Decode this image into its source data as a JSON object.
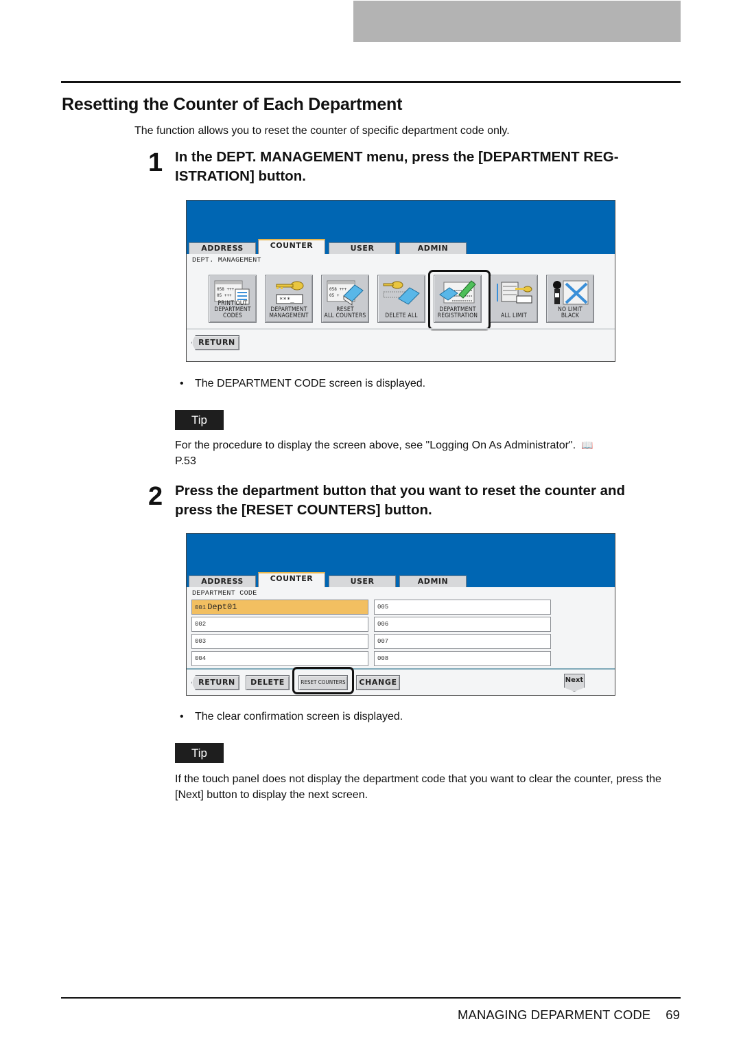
{
  "page": {
    "section_title": "Resetting the Counter of Each Department",
    "intro": "The function allows you to reset the counter of specific department code only.",
    "footer": {
      "chapter": "MANAGING DEPARMENT CODE",
      "page_number": "69"
    }
  },
  "steps": [
    {
      "number": "1",
      "text": "In the DEPT. MANAGEMENT menu, press the [DEPARTMENT REG-\nISTRATION] button.",
      "result": "The DEPARTMENT CODE screen is displayed.",
      "tip_label": "Tip",
      "tip_text": "For the procedure to display the screen above, see \"Logging On As Administrator\".",
      "tip_ref_icon": "book-icon",
      "tip_ref": "P.53"
    },
    {
      "number": "2",
      "text": "Press the department button that you want to reset the counter and\npress the [RESET COUNTERS] button.",
      "result": "The clear confirmation screen is displayed.",
      "tip_label": "Tip",
      "tip_text": "If the touch panel does not display the department code that you want to clear the counter, press the [Next] button to display the next screen."
    }
  ],
  "screen1": {
    "tabs": [
      "ADDRESS",
      "COUNTER",
      "USER",
      "ADMIN"
    ],
    "active_tab": "COUNTER",
    "label": "DEPT. MANAGEMENT",
    "functions": [
      {
        "label": "PRINT OUT\nDEPARTMENT CODES",
        "icon": "print-codes-icon"
      },
      {
        "label": "DEPARTMENT\nMANAGEMENT",
        "icon": "key-password-icon"
      },
      {
        "label": "RESET\nALL COUNTERS",
        "icon": "reset-counters-icon"
      },
      {
        "label": "DELETE ALL",
        "icon": "key-eraser-icon"
      },
      {
        "label": "DEPARTMENT\nREGISTRATION",
        "icon": "register-pencil-icon",
        "highlighted": true
      },
      {
        "label": "ALL LIMIT",
        "icon": "paper-stack-key-icon"
      },
      {
        "label": "NO LIMIT\nBLACK",
        "icon": "toner-no-limit-icon"
      }
    ],
    "return_label": "RETURN"
  },
  "screen2": {
    "tabs": [
      "ADDRESS",
      "COUNTER",
      "USER",
      "ADMIN"
    ],
    "active_tab": "COUNTER",
    "label": "DEPARTMENT CODE",
    "departments": [
      {
        "code": "001",
        "name": "Dept01",
        "selected": true
      },
      {
        "code": "002",
        "name": ""
      },
      {
        "code": "003",
        "name": ""
      },
      {
        "code": "004",
        "name": ""
      },
      {
        "code": "005",
        "name": ""
      },
      {
        "code": "006",
        "name": ""
      },
      {
        "code": "007",
        "name": ""
      },
      {
        "code": "008",
        "name": ""
      }
    ],
    "buttons": {
      "return": "RETURN",
      "delete": "DELETE",
      "reset_counters": "RESET COUNTERS",
      "change": "CHANGE",
      "next": "Next"
    }
  },
  "colors": {
    "panel_blue": "#0066b3",
    "selected_cell": "#f2bf61",
    "tab_accent": "#e8b54a"
  }
}
